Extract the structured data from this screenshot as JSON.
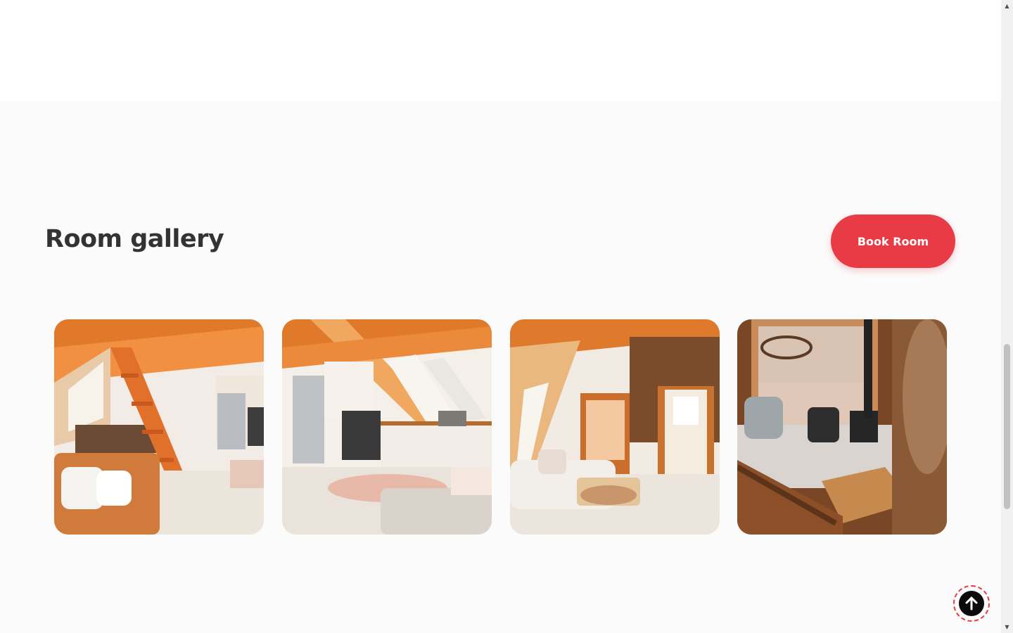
{
  "gallery": {
    "title": "Room gallery",
    "book_button_label": "Book Room",
    "images": [
      {
        "name": "loft-staircase-photo"
      },
      {
        "name": "kitchen-photo"
      },
      {
        "name": "living-room-photo"
      },
      {
        "name": "lounge-overview-photo"
      }
    ]
  },
  "back_to_top": {
    "icon": "arrow-up-icon"
  },
  "colors": {
    "accent": "#e83b45",
    "title": "#333333",
    "background": "#fcfbfb"
  }
}
